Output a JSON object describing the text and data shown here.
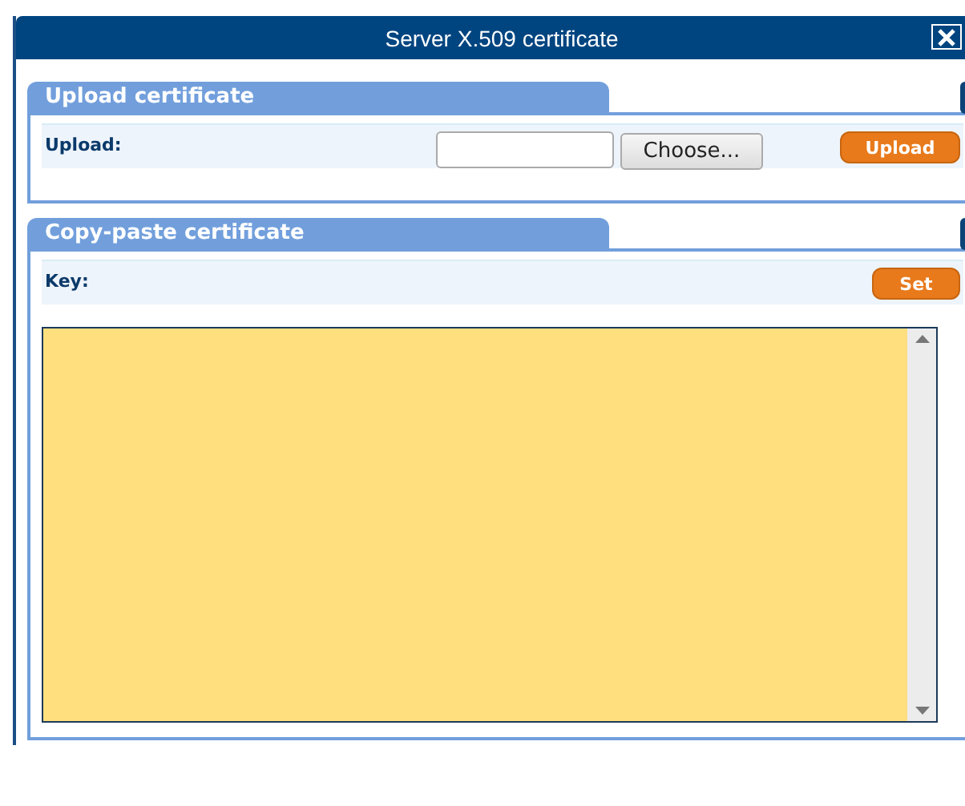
{
  "window": {
    "title": "Server X.509 certificate"
  },
  "panels": [
    {
      "kind": "upload",
      "title": "Upload certificate",
      "label": "Upload:",
      "file_button": "Choose...",
      "action": "Upload"
    },
    {
      "kind": "paste",
      "title": "Copy-paste certificate",
      "label": "Key:",
      "action": "Set"
    }
  ]
}
